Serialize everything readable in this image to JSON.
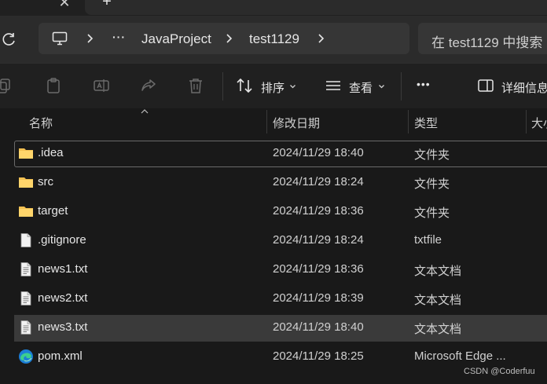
{
  "address": {
    "crumbs": [
      "JavaProject",
      "test1129"
    ],
    "overflow": "···",
    "search_placeholder": "在 test1129 中搜索"
  },
  "toolbar": {
    "sort_label": "排序",
    "view_label": "查看",
    "more_label": "•••",
    "details_label": "详细信息"
  },
  "columns": [
    "名称",
    "修改日期",
    "类型",
    "大小"
  ],
  "files": [
    {
      "name": ".idea",
      "modified": "2024/11/29 18:40",
      "type": "文件夹",
      "icon": "folder-icon"
    },
    {
      "name": "src",
      "modified": "2024/11/29 18:24",
      "type": "文件夹",
      "icon": "folder-icon"
    },
    {
      "name": "target",
      "modified": "2024/11/29 18:36",
      "type": "文件夹",
      "icon": "folder-icon"
    },
    {
      "name": ".gitignore",
      "modified": "2024/11/29 18:24",
      "type": "txtfile",
      "icon": "blank-file-icon"
    },
    {
      "name": "news1.txt",
      "modified": "2024/11/29 18:36",
      "type": "文本文档",
      "icon": "text-file-icon"
    },
    {
      "name": "news2.txt",
      "modified": "2024/11/29 18:39",
      "type": "文本文档",
      "icon": "text-file-icon"
    },
    {
      "name": "news3.txt",
      "modified": "2024/11/29 18:40",
      "type": "文本文档",
      "icon": "text-file-icon"
    },
    {
      "name": "pom.xml",
      "modified": "2024/11/29 18:25",
      "type": "Microsoft Edge ...",
      "icon": "edge-icon"
    }
  ],
  "watermark": "CSDN @Coderfuu",
  "colors": {
    "folder": "#f4c152",
    "background": "#191919",
    "toolbar": "#202020",
    "selected_row": "#3a3a3a"
  }
}
